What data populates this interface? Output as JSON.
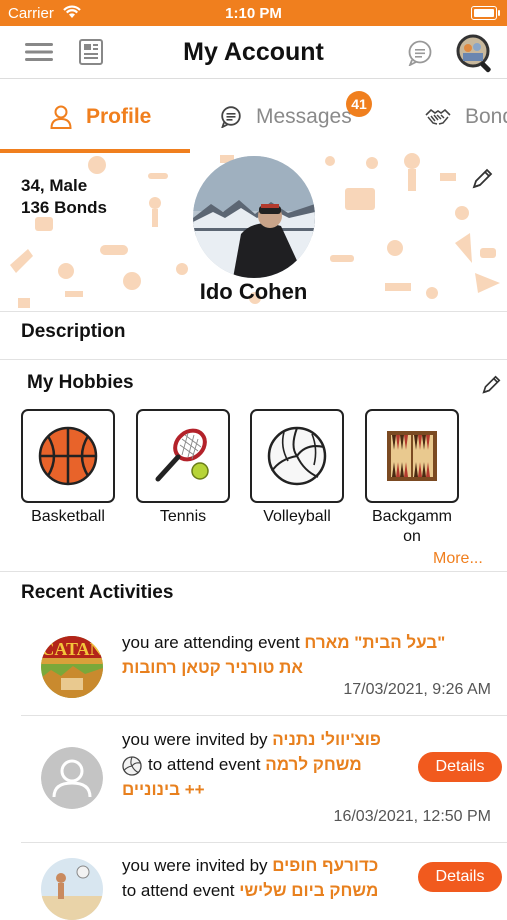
{
  "status_bar": {
    "carrier": "Carrier",
    "time": "1:10 PM"
  },
  "nav": {
    "title": "My Account"
  },
  "tabs": [
    {
      "label": "Profile",
      "active": true
    },
    {
      "label": "Messages",
      "badge": "41"
    },
    {
      "label": "Bonds"
    }
  ],
  "profile": {
    "age_gender": "34, Male",
    "bonds": "136 Bonds",
    "name": "Ido Cohen"
  },
  "sections": {
    "description": "Description",
    "hobbies": "My Hobbies",
    "recent": "Recent Activities"
  },
  "hobbies": [
    {
      "label": "Basketball",
      "icon": "basketball-icon"
    },
    {
      "label": "Tennis",
      "icon": "tennis-icon"
    },
    {
      "label": "Volleyball",
      "icon": "volleyball-icon"
    },
    {
      "label": "Backgamm on",
      "line1": "Backgamm",
      "line2": "on",
      "icon": "backgammon-icon"
    }
  ],
  "more_label": "More...",
  "activities": [
    {
      "text": "you are attending event",
      "event": "\"בעל הבית\" מארח את טורניר קטאן רחובות",
      "event_line1": "\"בעל הבית\" מארח",
      "event_line2": "את טורניר קטאן רחובות",
      "time": "17/03/2021, 9:26 AM"
    },
    {
      "text_prefix": "you were invited by",
      "inviter": "פוצ'יוולי נתניה",
      "text_mid": "to attend event",
      "event": "משחק לרמה ++ בינוניים",
      "event_line1": "משחק לרמה",
      "event_line2": "++ בינוניים",
      "time": "16/03/2021, 12:50 PM",
      "button": "Details"
    },
    {
      "text_prefix": "you were invited by",
      "inviter": "כדורעף חופים",
      "text_mid": "to attend event",
      "event": "משחק ביום שלישי",
      "button": "Details"
    }
  ],
  "colors": {
    "accent": "#f07f1e",
    "button": "#f15a1e"
  }
}
